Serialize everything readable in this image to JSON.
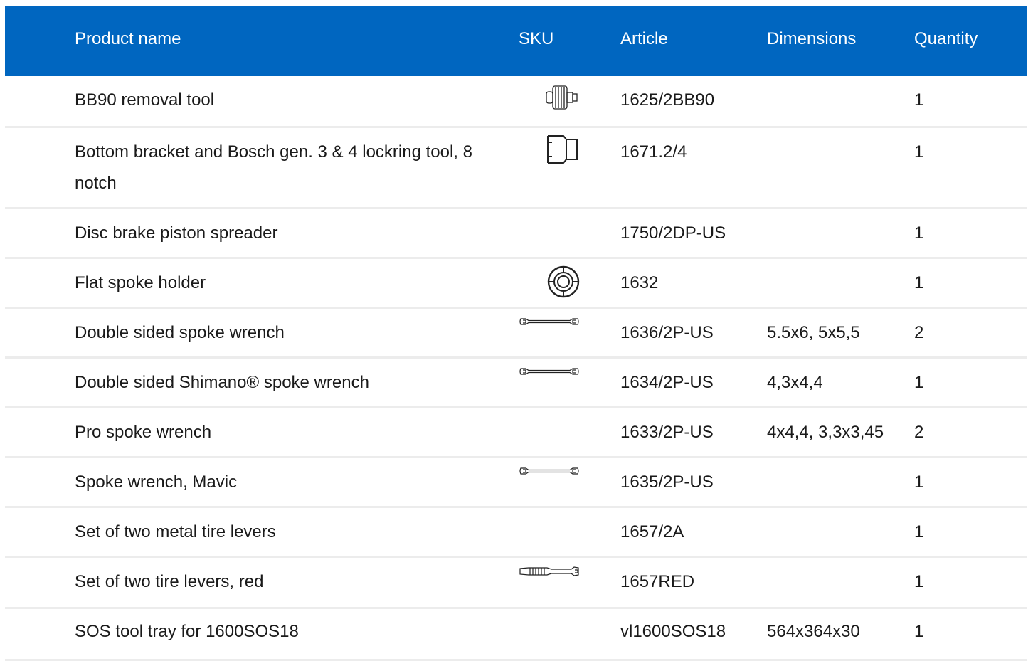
{
  "columns": {
    "product_name": "Product name",
    "sku": "SKU",
    "article": "Article",
    "dimensions": "Dimensions",
    "quantity": "Quantity"
  },
  "colors": {
    "header_bg": "#0066c0",
    "header_text": "#ffffff",
    "row_divider": "#ececec"
  },
  "rows": [
    {
      "name": "BB90 removal tool",
      "sku_icon": "bb90-tool-icon",
      "article": "1625/2BB90",
      "dimensions": "",
      "quantity": "1"
    },
    {
      "name": "Bottom bracket and Bosch gen. 3 & 4 lockring tool, 8 notch",
      "sku_icon": "lockring-tool-icon",
      "article": "1671.2/4",
      "dimensions": "",
      "quantity": "1"
    },
    {
      "name": "Disc brake piston spreader",
      "sku_icon": "",
      "article": "1750/2DP-US",
      "dimensions": "",
      "quantity": "1"
    },
    {
      "name": "Flat spoke holder",
      "sku_icon": "spoke-holder-icon",
      "article": "1632",
      "dimensions": "",
      "quantity": "1"
    },
    {
      "name": "Double sided spoke wrench",
      "sku_icon": "spoke-wrench-icon",
      "article": "1636/2P-US",
      "dimensions": "5.5x6, 5x5,5",
      "quantity": "2"
    },
    {
      "name": "Double sided Shimano® spoke wrench",
      "sku_icon": "spoke-wrench-icon",
      "article": "1634/2P-US",
      "dimensions": "4,3x4,4",
      "quantity": "1"
    },
    {
      "name": "Pro spoke wrench",
      "sku_icon": "",
      "article": "1633/2P-US",
      "dimensions": "4x4,4, 3,3x3,45",
      "quantity": "2"
    },
    {
      "name": "Spoke wrench, Mavic",
      "sku_icon": "spoke-wrench-icon",
      "article": "1635/2P-US",
      "dimensions": "",
      "quantity": "1"
    },
    {
      "name": "Set of two metal tire levers",
      "sku_icon": "",
      "article": "1657/2A",
      "dimensions": "",
      "quantity": "1"
    },
    {
      "name": "Set of two tire levers, red",
      "sku_icon": "tire-lever-icon",
      "article": "1657RED",
      "dimensions": "",
      "quantity": "1"
    },
    {
      "name": "SOS tool tray for 1600SOS18",
      "sku_icon": "",
      "article": "vl1600SOS18",
      "dimensions": "564x364x30",
      "quantity": "1"
    }
  ]
}
